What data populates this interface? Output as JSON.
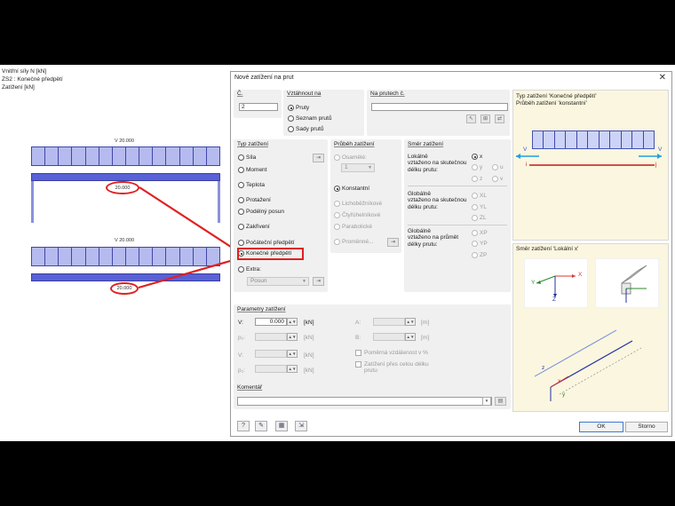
{
  "viewport": {
    "info_lines": [
      "Vnitřní síly N [kN]",
      "ZS2 : Konečné předpětí",
      "Zatížení [kN]"
    ],
    "beam1_label": "V 20.000",
    "beam1_value": "20.000",
    "beam2_label": "V 20.000",
    "beam2_value": "20.000"
  },
  "dialog": {
    "title": "Nové zatížení na prut",
    "close_symbol": "✕",
    "no": {
      "label": "Č.",
      "value": "2"
    },
    "relate": {
      "title": "Vztáhnout na",
      "options": [
        "Pruty",
        "Seznam prutů",
        "Sady prutů"
      ],
      "selected": "Pruty"
    },
    "on_members": {
      "label": "Na prutech č.",
      "value": ""
    },
    "load_type": {
      "title": "Typ zatížení",
      "options": [
        "Síla",
        "Moment",
        "Teplota",
        "Protažení",
        "Podélný posun",
        "Zakřivení",
        "Počáteční předpětí",
        "Konečné předpětí",
        "Extra:"
      ],
      "selected": "Konečné předpětí",
      "extra_value": "Posun"
    },
    "distribution": {
      "title": "Průběh zatížení",
      "options": [
        "Osamělé:",
        "Konstantní",
        "Lichoběžníkové",
        "Čtyřúhelníkové",
        "Parabolické",
        "Proměnné..."
      ],
      "selected": "Konstantní",
      "concentrated_value": "1"
    },
    "direction": {
      "title": "Směr zatížení",
      "local_label": "Lokálně\nvztaženo na skutečnou\ndélku prutu:",
      "local_opts": [
        "x",
        "y",
        "z"
      ],
      "local_sel": "x",
      "u_opts": [
        "u",
        "v"
      ],
      "global_true_label": "Globálně\nvztaženo na skutečnou\ndélku prutu:",
      "global_true_opts": [
        "XL",
        "YL",
        "ZL"
      ],
      "global_proj_label": "Globálně\nvztaženo na průmět\ndélky prutu:",
      "global_proj_opts": [
        "XP",
        "YP",
        "ZP"
      ]
    },
    "params": {
      "title": "Parametry zatížení",
      "v_label": "V:",
      "v_value": "0.000",
      "unit": "[kN]",
      "p2_label": "p₂:",
      "v2_label": "V:",
      "p2b_label": "p₂:",
      "a_label": "A:",
      "b_label": "B:",
      "ab_unit": "[m]",
      "rel_dist": "Poměrná vzdálenost v %",
      "full_len": "Zatížení přes celou délku prutu"
    },
    "comment": {
      "title": "Komentář",
      "value": ""
    },
    "preview_top": {
      "line1": "Typ zatížení 'Konečné předpětí'",
      "line2": "Průběh zatížení 'konstantní'",
      "v_left": "V",
      "v_right": "V",
      "i_label": "i",
      "j_label": "j"
    },
    "preview_bottom": {
      "title": "Směr zatížení 'Lokální x'",
      "axes": [
        "Y",
        "X",
        "Z"
      ],
      "beam_labels": [
        "x",
        "y",
        "z"
      ]
    },
    "ok_label": "OK",
    "cancel_label": "Storno"
  },
  "colors": {
    "highlight": "#e02020",
    "beam": "#5961d6",
    "preview_bg": "#fbf6df"
  }
}
